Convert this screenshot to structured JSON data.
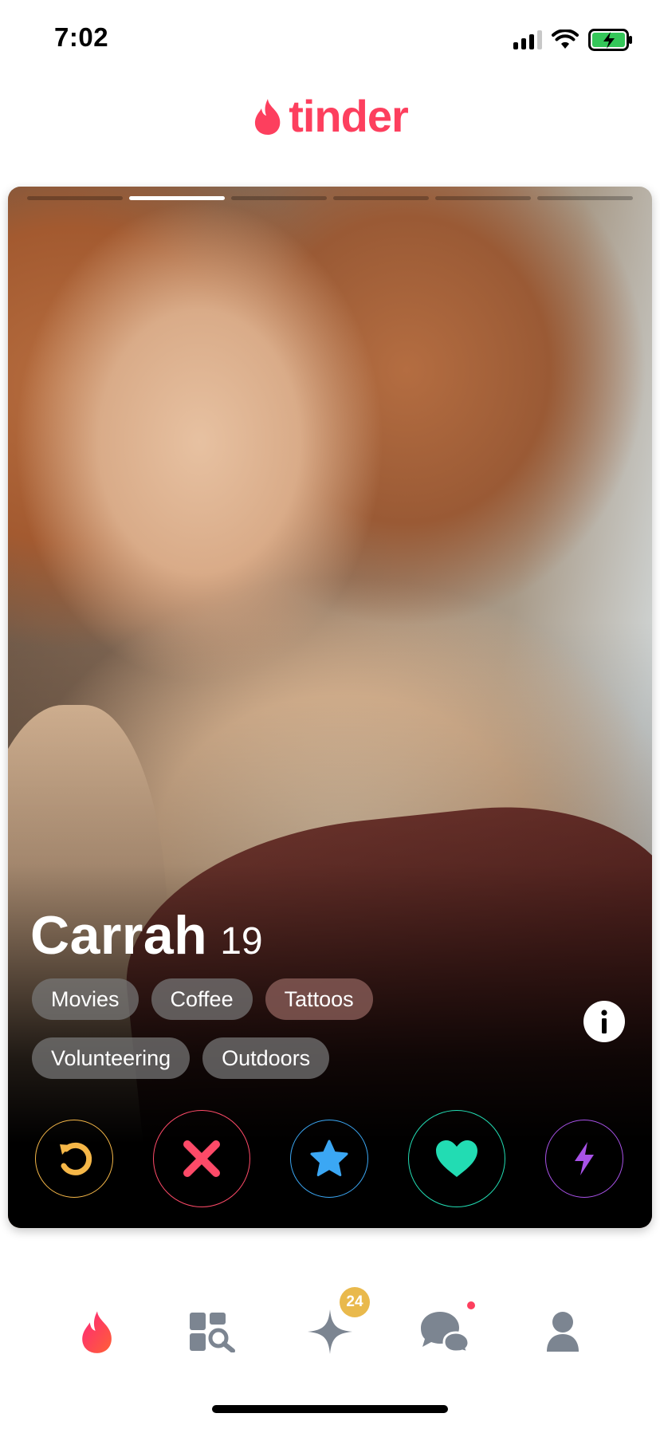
{
  "status": {
    "time": "7:02"
  },
  "app": {
    "logo_text": "tinder",
    "brand_color": "#fd3f5e"
  },
  "card": {
    "photo_count": 6,
    "active_photo": 2,
    "name": "Carrah",
    "age": "19",
    "interests": [
      {
        "label": "Movies",
        "shared": false
      },
      {
        "label": "Coffee",
        "shared": false
      },
      {
        "label": "Tattoos",
        "shared": true
      },
      {
        "label": "Volunteering",
        "shared": false
      },
      {
        "label": "Outdoors",
        "shared": false
      }
    ]
  },
  "actions": [
    {
      "name": "rewind",
      "icon": "rewind-icon",
      "color": "#f5b748"
    },
    {
      "name": "nope",
      "icon": "close-icon",
      "color": "#fd4a68"
    },
    {
      "name": "super-like",
      "icon": "star-icon",
      "color": "#3ba7f4"
    },
    {
      "name": "like",
      "icon": "heart-icon",
      "color": "#22dcb3"
    },
    {
      "name": "boost",
      "icon": "bolt-icon",
      "color": "#a852e8"
    }
  ],
  "nav": {
    "items": [
      "tinder-flame-icon",
      "explore-icon",
      "gold-home-icon",
      "messages-icon",
      "profile-icon"
    ],
    "likes_badge": "24"
  }
}
